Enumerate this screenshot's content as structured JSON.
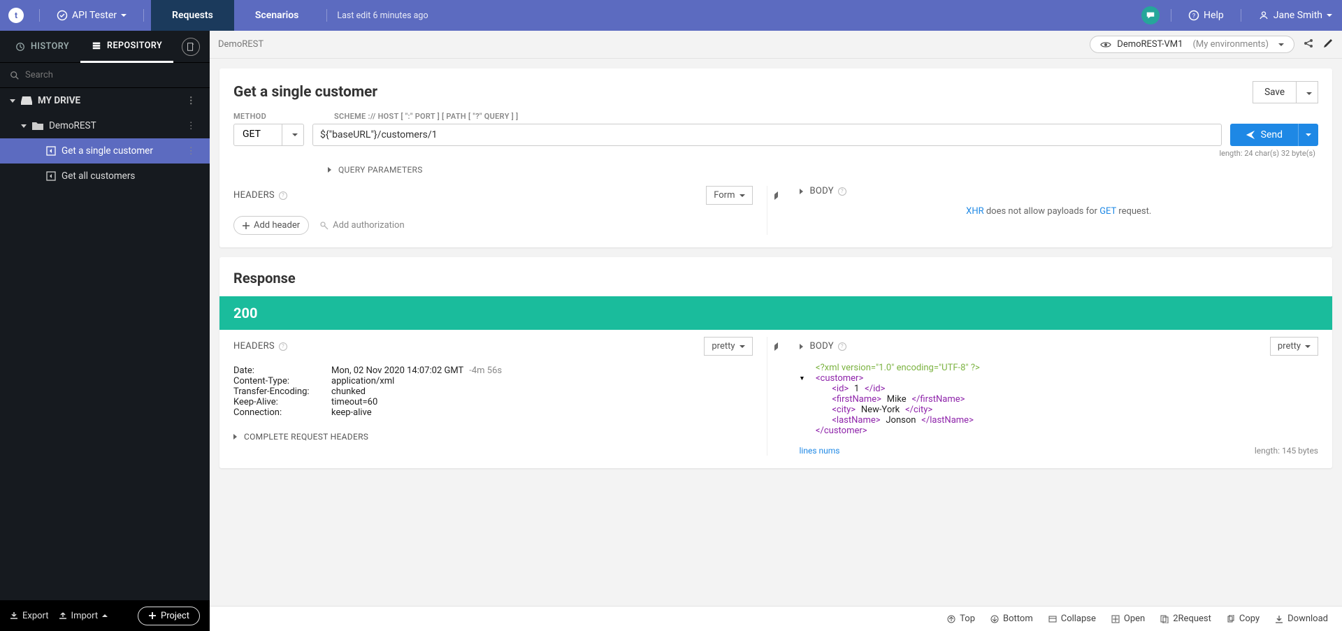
{
  "topbar": {
    "product": "API Tester",
    "tabs": {
      "requests": "Requests",
      "scenarios": "Scenarios"
    },
    "last_edit": "Last edit 6 minutes ago",
    "help": "Help",
    "user": "Jane Smith"
  },
  "sidebar": {
    "tabs": {
      "history": "HISTORY",
      "repository": "REPOSITORY"
    },
    "search_placeholder": "Search",
    "drive_label": "MY DRIVE",
    "project": "DemoREST",
    "items": [
      {
        "label": "Get a single customer"
      },
      {
        "label": "Get all customers"
      }
    ],
    "footer": {
      "export": "Export",
      "import": "Import",
      "project": "Project"
    }
  },
  "header": {
    "breadcrumb": "DemoREST",
    "env_name": "DemoREST-VM1",
    "env_scope": "(My environments)"
  },
  "request": {
    "title": "Get a single customer",
    "save": "Save",
    "method_label": "METHOD",
    "url_label": "SCHEME :// HOST [ \":\" PORT ] [ PATH [ \"?\" QUERY ] ]",
    "method": "GET",
    "url": "${\"baseURL\"}/customers/1",
    "send": "Send",
    "length_info": "length: 24 char(s) 32 byte(s)",
    "query_params_label": "QUERY PARAMETERS",
    "headers_label": "HEADERS",
    "form_dd": "Form",
    "add_header": "Add header",
    "add_auth": "Add authorization",
    "body_label": "BODY",
    "xhr_pre": "XHR",
    "xhr_mid": " does not allow payloads for ",
    "xhr_method": "GET",
    "xhr_post": " request."
  },
  "response": {
    "title": "Response",
    "status": "200",
    "headers_label": "HEADERS",
    "pretty": "pretty",
    "body_label": "BODY",
    "headers": [
      {
        "k": "Date:",
        "v": "Mon, 02 Nov 2020 14:07:02 GMT",
        "extra": "-4m 56s"
      },
      {
        "k": "Content-Type:",
        "v": "application/xml",
        "extra": ""
      },
      {
        "k": "Transfer-Encoding:",
        "v": "chunked",
        "extra": ""
      },
      {
        "k": "Keep-Alive:",
        "v": "timeout=60",
        "extra": ""
      },
      {
        "k": "Connection:",
        "v": "keep-alive",
        "extra": ""
      }
    ],
    "complete_headers": "COMPLETE REQUEST HEADERS",
    "xml": {
      "decl": "<?xml version=\"1.0\" encoding=\"UTF-8\" ?>",
      "root_open": "customer",
      "fields": [
        {
          "tag": "id",
          "val": "1"
        },
        {
          "tag": "firstName",
          "val": "Mike"
        },
        {
          "tag": "city",
          "val": "New-York"
        },
        {
          "tag": "lastName",
          "val": "Jonson"
        }
      ],
      "root_close": "customer"
    },
    "lines_nums": "lines nums",
    "body_length": "length: 145 bytes"
  },
  "footer": {
    "top": "Top",
    "bottom": "Bottom",
    "collapse": "Collapse",
    "open": "Open",
    "torequest": "2Request",
    "copy": "Copy",
    "download": "Download"
  }
}
